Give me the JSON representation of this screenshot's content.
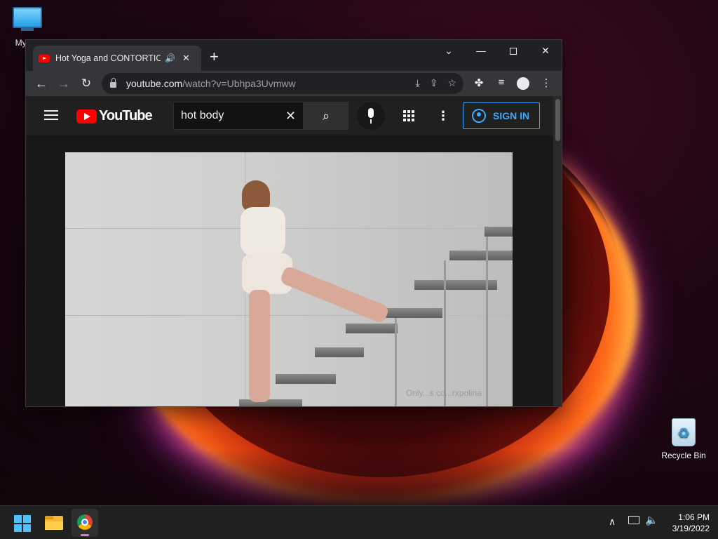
{
  "desktop": {
    "icons": [
      {
        "label": "My Co"
      },
      {
        "label": "Recycle Bin"
      }
    ]
  },
  "browser": {
    "tab": {
      "title": "Hot Yoga and CONTORTION.",
      "audio_icon": "speaker-icon",
      "close_icon": "close-icon"
    },
    "new_tab_label": "+",
    "address": {
      "domain": "youtube.com",
      "path": "/watch?v=Ubhpa3Uvmww"
    }
  },
  "youtube": {
    "logo_text": "YouTube",
    "search": {
      "value": "hot body"
    },
    "signin_label": "SIGN IN",
    "video": {
      "watermark": "Only...s.co...rxpolina"
    }
  },
  "taskbar": {
    "clock": {
      "time": "1:06 PM",
      "date": "3/19/2022"
    }
  },
  "colors": {
    "youtube_red": "#ff0000",
    "signin_blue": "#3ea6ff",
    "chrome_dark": "#202124"
  }
}
